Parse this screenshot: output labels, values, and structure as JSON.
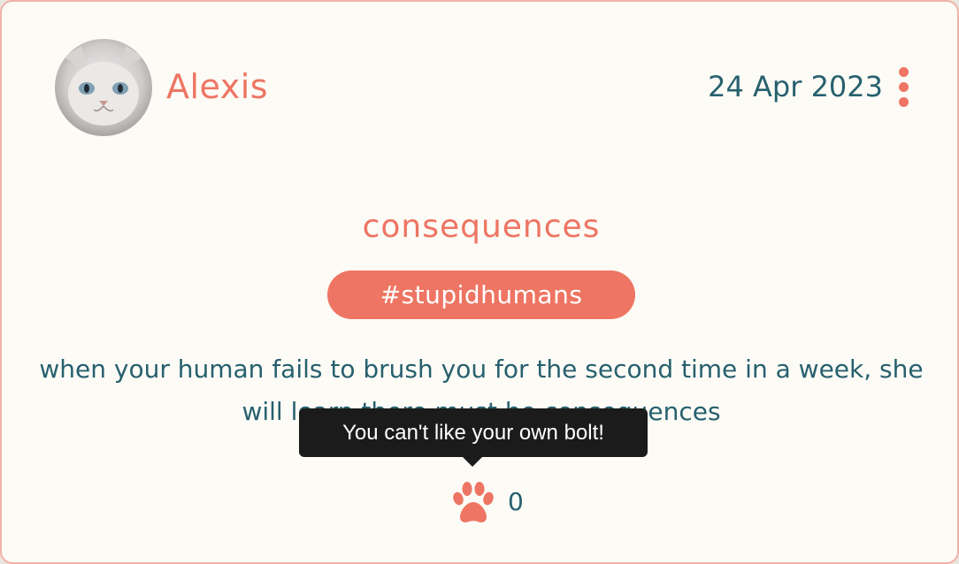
{
  "post": {
    "author": "Alexis",
    "date": "24 Apr 2023",
    "title": "consequences",
    "tag": "#stupidhumans",
    "body": "when your human fails to brush you for the second time in a week, she will learn there must be consequences",
    "like_count": "0",
    "like_tooltip": "You can't like your own bolt!"
  },
  "icons": {
    "avatar": "cat-avatar",
    "menu": "kebab-menu-icon",
    "like": "paw-icon"
  },
  "colors": {
    "accent": "#ee7563",
    "text": "#27606e",
    "card_bg": "#fdfbf6",
    "card_border": "#f2b1a6",
    "tooltip_bg": "#1b1b1b"
  }
}
